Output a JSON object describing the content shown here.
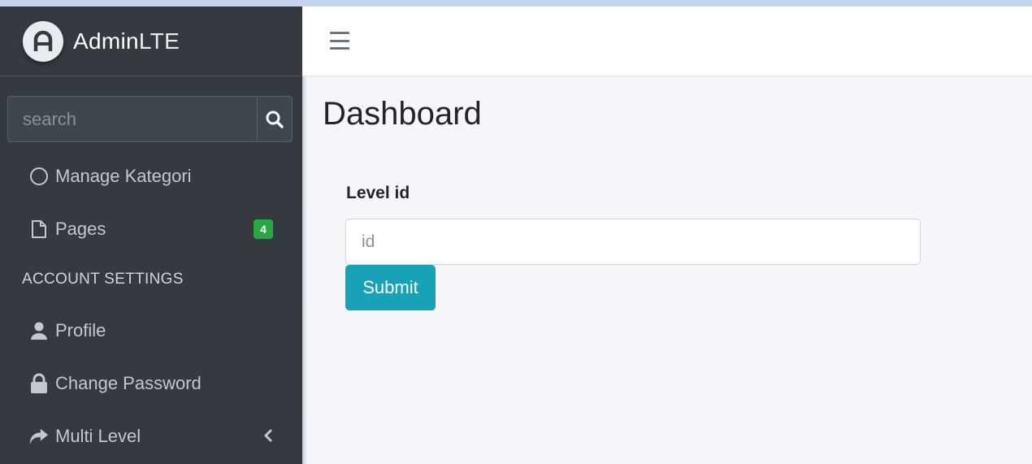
{
  "brand": {
    "name_bold": "Admin",
    "name_light": "LTE",
    "logo_icon": "adminlte-logo"
  },
  "search": {
    "placeholder": "search",
    "button_icon": "search-icon"
  },
  "sidebar": {
    "items": [
      {
        "label": "Manage Kategori",
        "icon": "circle-outline-icon"
      },
      {
        "label": "Pages",
        "icon": "file-icon",
        "badge": "4"
      }
    ],
    "section_header": "ACCOUNT SETTINGS",
    "account_items": [
      {
        "label": "Profile",
        "icon": "user-icon"
      },
      {
        "label": "Change Password",
        "icon": "lock-icon"
      },
      {
        "label": "Multi Level",
        "icon": "share-icon",
        "expand_icon": "chevron-left-icon"
      }
    ]
  },
  "topbar": {
    "menu_icon": "hamburger-icon"
  },
  "page": {
    "title": "Dashboard"
  },
  "form": {
    "label": "Level id",
    "input_placeholder": "id",
    "input_value": "",
    "submit_label": "Submit"
  },
  "colors": {
    "sidebar_bg": "#343a40",
    "content_bg": "#f4f6f9",
    "submit_bg": "#17a2b8",
    "badge_bg": "#28a745"
  }
}
